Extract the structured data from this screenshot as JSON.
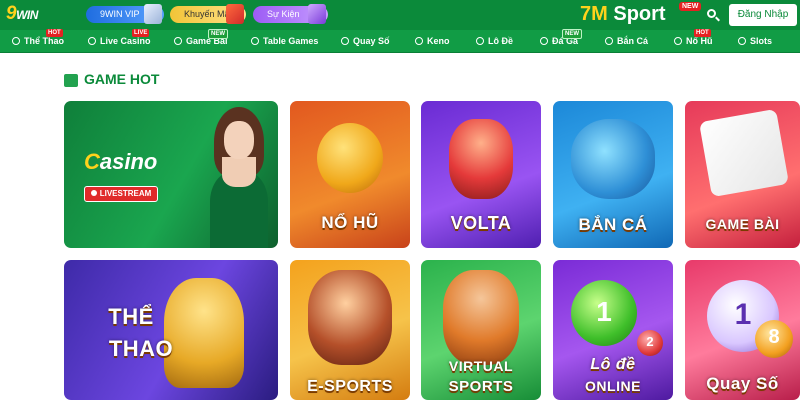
{
  "header": {
    "logo_main": "9",
    "logo_sub": "WIN",
    "promos": [
      "9WIN VIP",
      "Khuyến Mãi",
      "Sự Kiện"
    ],
    "brand_7m": "7M",
    "brand_sport": "Sport",
    "brand_new": "NEW",
    "login": "Đăng Nhập"
  },
  "nav": {
    "items": [
      {
        "label": "Thể Thao",
        "tag": "HOT"
      },
      {
        "label": "Live Casino",
        "tag": "LIVE"
      },
      {
        "label": "Game Bài",
        "tag": "NEW"
      },
      {
        "label": "Table Games",
        "tag": ""
      },
      {
        "label": "Quay Số",
        "tag": ""
      },
      {
        "label": "Keno",
        "tag": ""
      },
      {
        "label": "Lô Đề",
        "tag": ""
      },
      {
        "label": "Đá Gà",
        "tag": "NEW"
      },
      {
        "label": "Bắn Cá",
        "tag": ""
      },
      {
        "label": "Nổ Hũ",
        "tag": "HOT"
      },
      {
        "label": "Slots",
        "tag": ""
      }
    ]
  },
  "section": {
    "title": "GAME HOT"
  },
  "cards": {
    "casino": {
      "title_c": "C",
      "title_rest": "asino",
      "badge": "LIVESTREAM"
    },
    "nohu": {
      "label": "NỔ HŨ"
    },
    "volta": {
      "label": "VOLTA"
    },
    "banca": {
      "label": "BẮN CÁ"
    },
    "gamebai": {
      "label": "GAME BÀI"
    },
    "thethao": {
      "line1": "THỂ",
      "line2": "THAO"
    },
    "esports": {
      "label": "E-SPORTS"
    },
    "virtual": {
      "line1": "VIRTUAL",
      "line2": "SPORTS"
    },
    "lode": {
      "line1": "Lô đề",
      "line2": "ONLINE",
      "ball": "1",
      "ball2": "2"
    },
    "quayso": {
      "label": "Quay Số",
      "ball": "1",
      "ball2": "8"
    }
  },
  "colors": {
    "header_green": "#0b8a3a",
    "nav_green": "#119c45",
    "accent_yellow": "#ffd21c",
    "hot_red": "#e52222"
  }
}
